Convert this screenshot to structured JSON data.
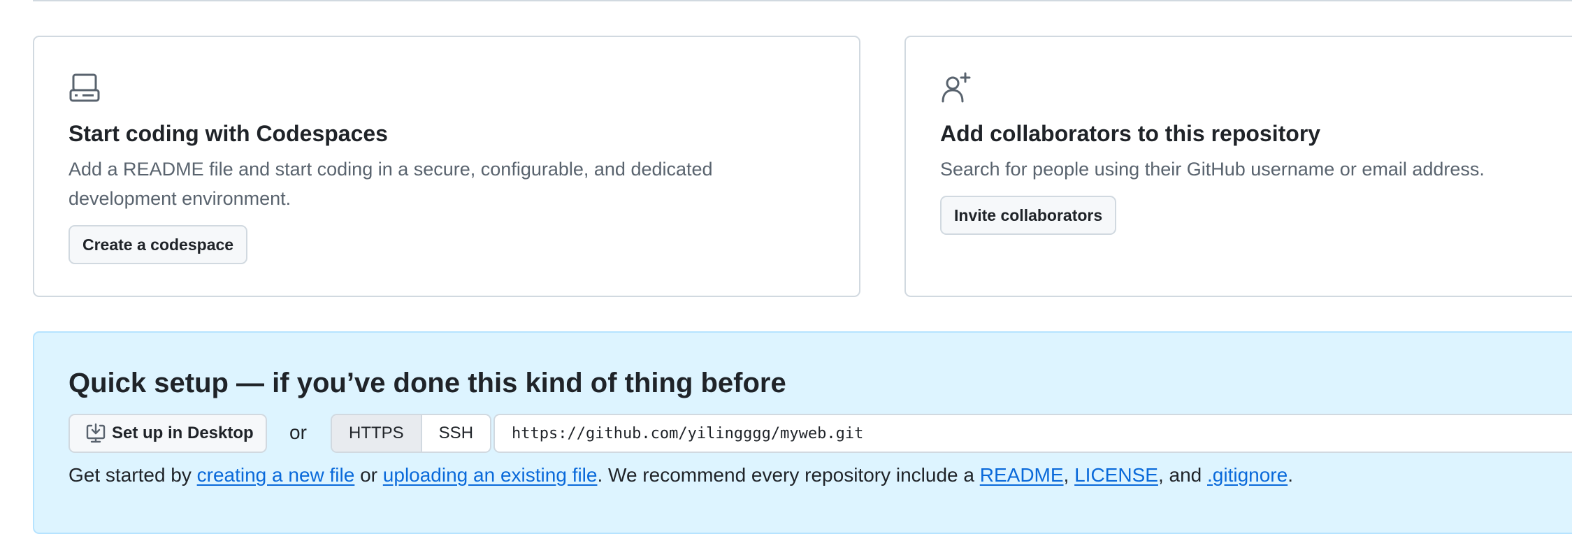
{
  "codespaces_card": {
    "icon": "device-desktop-icon",
    "title": "Start coding with Codespaces",
    "description": "Add a README file and start coding in a secure, configurable, and dedicated development environment.",
    "button_label": "Create a codespace"
  },
  "collaborators_card": {
    "icon": "person-add-icon",
    "title": "Add collaborators to this repository",
    "description": "Search for people using their GitHub username or email address.",
    "button_label": "Invite collaborators"
  },
  "quick_setup": {
    "title": "Quick setup — if you’ve done this kind of thing before",
    "desktop_button_icon": "desktop-download-icon",
    "desktop_button_label": "Set up in Desktop",
    "or_label": "or",
    "protocols": [
      {
        "label": "HTTPS",
        "selected": true
      },
      {
        "label": "SSH",
        "selected": false
      }
    ],
    "clone_url": "https://github.com/yilingggg/myweb.git",
    "get_started": {
      "prefix": "Get started by ",
      "link_new_file": "creating a new file",
      "mid1": " or ",
      "link_upload": "uploading an existing file",
      "mid2": ". We recommend every repository include a ",
      "link_readme": "README",
      "sep1": ", ",
      "link_license": "LICENSE",
      "sep2": ", and ",
      "link_gitignore": ".gitignore",
      "suffix": "."
    }
  },
  "colors": {
    "accent_link": "#0969da",
    "quick_setup_bg": "#ddf4ff",
    "border": "#d1d9e0",
    "muted_text": "#59636e"
  }
}
